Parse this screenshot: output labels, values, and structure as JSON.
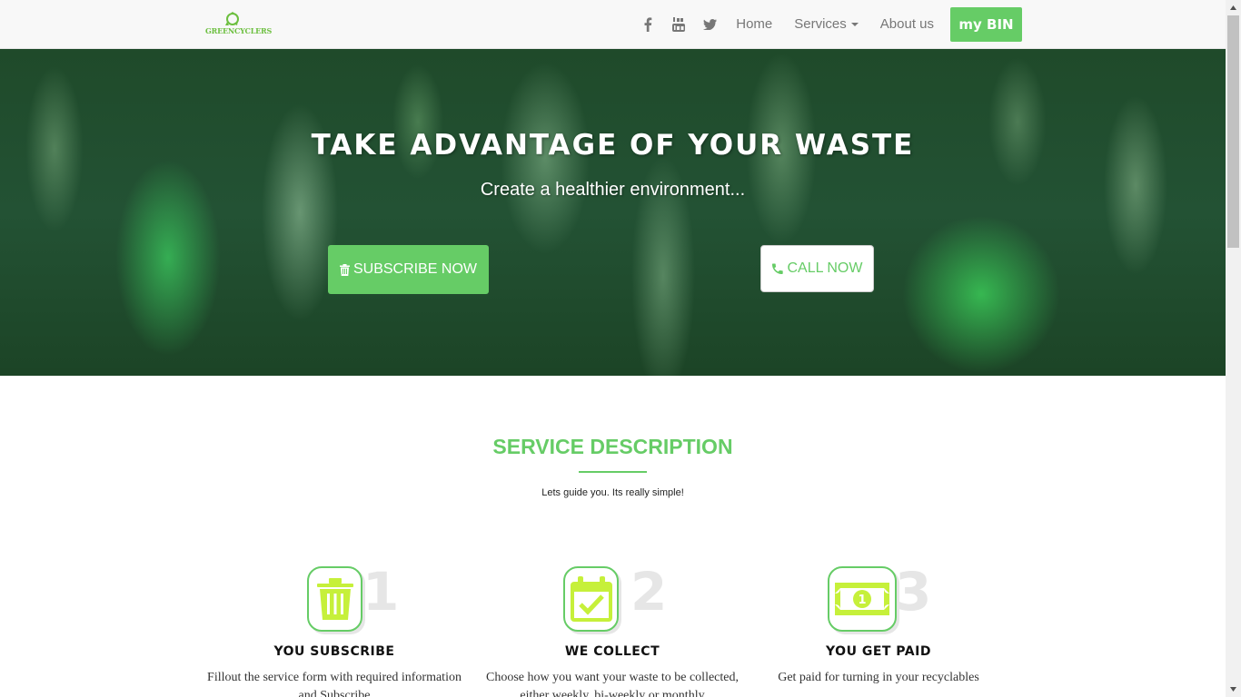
{
  "brand": {
    "name": "GREENCYCLERS"
  },
  "nav": {
    "social": [
      {
        "name": "facebook",
        "glyph": "f"
      },
      {
        "name": "youtube",
        "glyph": "You"
      },
      {
        "name": "twitter",
        "glyph": "t"
      }
    ],
    "home": "Home",
    "services": "Services",
    "about": "About us",
    "bin": "my BIN"
  },
  "hero": {
    "title": "TAKE ADVANTAGE OF YOUR WASTE",
    "subtitle": "Create a healthier environment...",
    "subscribe": "SUBSCRIBE NOW",
    "call": "CALL NOW"
  },
  "service": {
    "title": "SERVICE DESCRIPTION",
    "subtitle": "Lets guide you. Its really simple!",
    "steps": [
      {
        "num": "1",
        "title": "YOU SUBSCRIBE",
        "desc": "Fillout the service form with required information and Subscribe",
        "icon": "trash-icon"
      },
      {
        "num": "2",
        "title": "WE COLLECT",
        "desc": "Choose how you want your waste to be collected, either weekly, bi-weekly or monthly",
        "icon": "calendar-check-icon"
      },
      {
        "num": "3",
        "title": "YOU GET PAID",
        "desc": "Get paid for turning in your recyclables",
        "icon": "money-icon"
      }
    ]
  },
  "colors": {
    "accent": "#66cc66",
    "icon": "#c6f03a",
    "nav_text": "#777777"
  }
}
